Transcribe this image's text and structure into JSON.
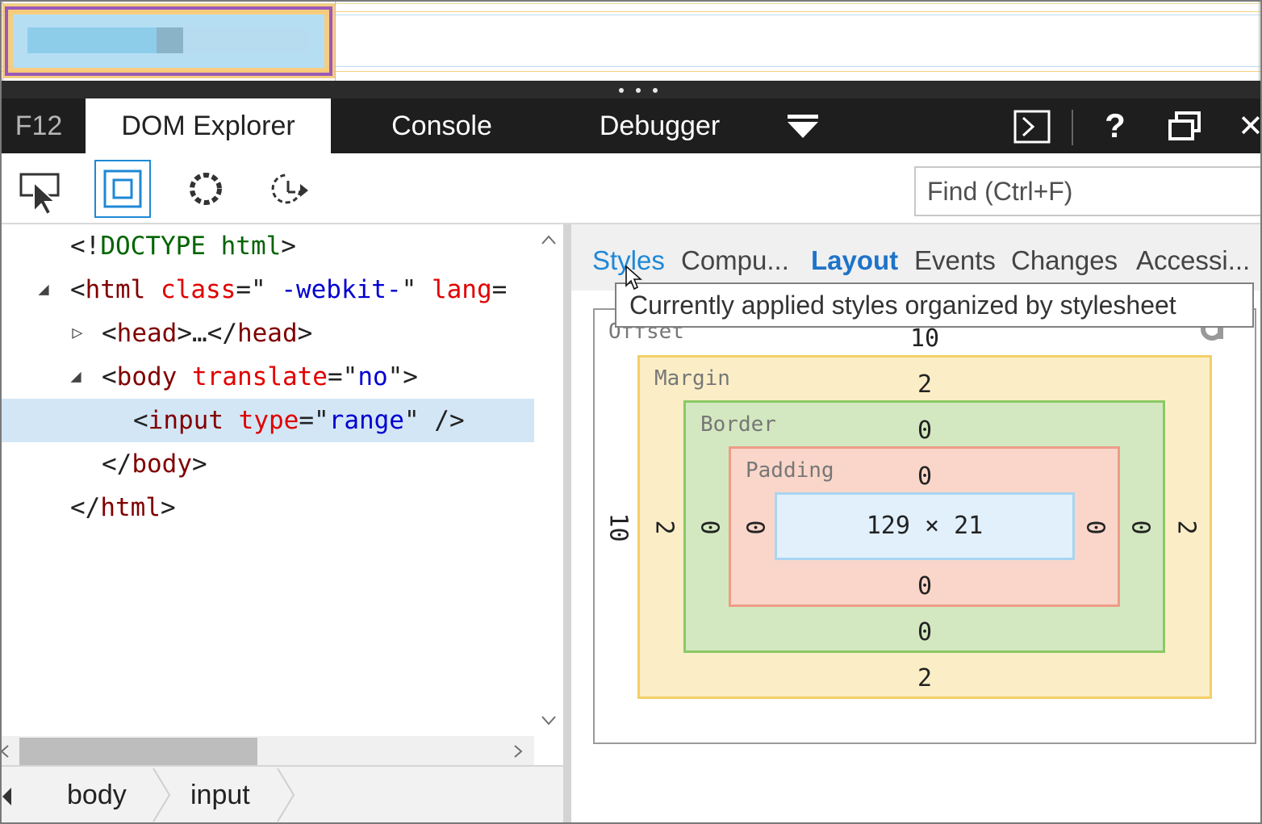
{
  "devtools": {
    "f12_label": "F12",
    "tabs": [
      {
        "label": "DOM Explorer",
        "active": true
      },
      {
        "label": "Console",
        "active": false
      },
      {
        "label": "Debugger",
        "active": false
      }
    ],
    "more_tabs_icon": "double-chevron-down-icon",
    "right_icons": [
      "console-prompt-icon",
      "help-icon",
      "undock-icon",
      "close-icon"
    ],
    "help_glyph": "?",
    "close_glyph": "✕"
  },
  "toolbar": {
    "tools": [
      "select-element-icon",
      "highlight-box-icon",
      "circle-dotted-icon",
      "refresh-pick-icon"
    ],
    "find_placeholder": "Find (Ctrl+F)"
  },
  "dom_tree": {
    "doctype": {
      "open": "<!",
      "name": "DOCTYPE html",
      "close": ">"
    },
    "html": {
      "open": "<",
      "tag": "html",
      "attr1": "class",
      "eq1": "=\"",
      "val1": " -webkit-",
      "q1": "\"",
      "attr2": "lang",
      "eq2": "="
    },
    "head": {
      "text_open": "<",
      "tag": "head",
      "mid": ">…</",
      "tag2": "head",
      "close": ">"
    },
    "body": {
      "open": "<",
      "tag": "body",
      "attr": "translate",
      "eq": "=\"",
      "val": "no",
      "close": "\">"
    },
    "input": {
      "open": "<",
      "tag": "input",
      "attr": "type",
      "eq": "=\"",
      "val": "range",
      "close": "\" />"
    },
    "body_close": {
      "open": "</",
      "tag": "body",
      "close": ">"
    },
    "html_close": {
      "open": "</",
      "tag": "html",
      "close": ">"
    },
    "twisty_expanded": "◢",
    "twisty_collapsed": "▷"
  },
  "breadcrumbs": [
    "body",
    "input"
  ],
  "right_pane": {
    "tabs": [
      "Styles",
      "Compu...",
      "Layout",
      "Events",
      "Changes",
      "Accessi..."
    ],
    "active_tab": "Layout",
    "tooltip": "Currently applied styles organized by stylesheet"
  },
  "box_model": {
    "offset": {
      "label": "Offset",
      "top": "10",
      "left": "10"
    },
    "margin": {
      "label": "Margin",
      "top": "2",
      "right": "2",
      "bottom": "2",
      "left": "2"
    },
    "border": {
      "label": "Border",
      "top": "0",
      "right": "0",
      "bottom": "0",
      "left": "0"
    },
    "padding": {
      "label": "Padding",
      "top": "0",
      "right": "0",
      "bottom": "0",
      "left": "0"
    },
    "content": "129 × 21"
  },
  "colors": {
    "margin_fill": "#fbeec7",
    "border_fill": "#d3e8c0",
    "padding_fill": "#f9d6c9",
    "content_fill": "#e1f0fb",
    "accent": "#1e88d6"
  }
}
